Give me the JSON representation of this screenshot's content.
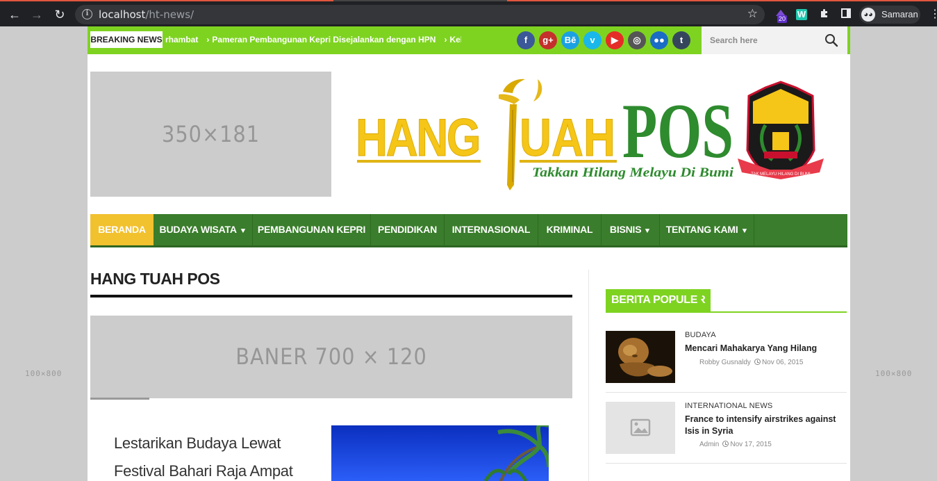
{
  "browser": {
    "url_host": "localhost",
    "url_path": "/ht-news/",
    "extension_badge": "20",
    "extension_w": "W",
    "profile_name": "Samaran"
  },
  "side_ads": {
    "left": "100×800",
    "right": "100×800"
  },
  "topbar": {
    "breaking_label": "BREAKING NEWS",
    "ticker": [
      "rhambat",
      "Pameran Pembangunan Kepri Disejalankan dengan HPN",
      "Kebutuha"
    ],
    "social": [
      {
        "icon": "facebook-icon",
        "glyph": "f",
        "color": "#3b5998"
      },
      {
        "icon": "google-plus-icon",
        "glyph": "g+",
        "color": "#c4302b"
      },
      {
        "icon": "behance-icon",
        "glyph": "Bē",
        "color": "#1ba1e2"
      },
      {
        "icon": "vimeo-icon",
        "glyph": "v",
        "color": "#1ab7ea"
      },
      {
        "icon": "youtube-icon",
        "glyph": "▶",
        "color": "#e52d27"
      },
      {
        "icon": "instagram-icon",
        "glyph": "◎",
        "color": "#555555"
      },
      {
        "icon": "flickr-icon",
        "glyph": "●●",
        "color": "#1a6cc4"
      },
      {
        "icon": "tumblr-icon",
        "glyph": "t",
        "color": "#35465c"
      }
    ],
    "search_placeholder": "Search here"
  },
  "header": {
    "ad_label": "350×181",
    "logo_hang": "HANG",
    "logo_uah": "UAH",
    "logo_pos": "POS",
    "logo_tagline": "Takkan Hilang Melayu Di Bumi",
    "emblem_ribbon": "TAK MELAYU HILANG DI BUMI"
  },
  "nav": [
    {
      "label": "BERANDA",
      "active": true,
      "dropdown": false
    },
    {
      "label": "BUDAYA WISATA",
      "active": false,
      "dropdown": true
    },
    {
      "label": "PEMBANGUNAN KEPRI",
      "active": false,
      "dropdown": false
    },
    {
      "label": "PENDIDIKAN",
      "active": false,
      "dropdown": false
    },
    {
      "label": "INTERNASIONAL",
      "active": false,
      "dropdown": false
    },
    {
      "label": "KRIMINAL",
      "active": false,
      "dropdown": false
    },
    {
      "label": "BISNIS",
      "active": false,
      "dropdown": true
    },
    {
      "label": "TENTANG KAMI",
      "active": false,
      "dropdown": true
    }
  ],
  "main": {
    "section_title": "HANG TUAH POS",
    "banner_label": "BANER 700 × 120",
    "article_title": "Lestarikan Budaya Lewat Festival Bahari Raja Ampat"
  },
  "sidebar": {
    "title": "BERITA POPULER",
    "items": [
      {
        "category": "BUDAYA",
        "title": "Mencari Mahakarya Yang Hilang",
        "author": "Robby Gusnaldy",
        "date": "Nov 06, 2015"
      },
      {
        "category": "INTERNATIONAL NEWS",
        "title": "France to intensify airstrikes against Isis in Syria",
        "author": "Admin",
        "date": "Nov 17, 2015"
      }
    ]
  },
  "colors": {
    "green_bright": "#7ed321",
    "green_nav": "#3a7d2c",
    "yellow_active": "#f2c12e",
    "logo_yellow": "#f5c518",
    "logo_green": "#2e8b2e"
  }
}
